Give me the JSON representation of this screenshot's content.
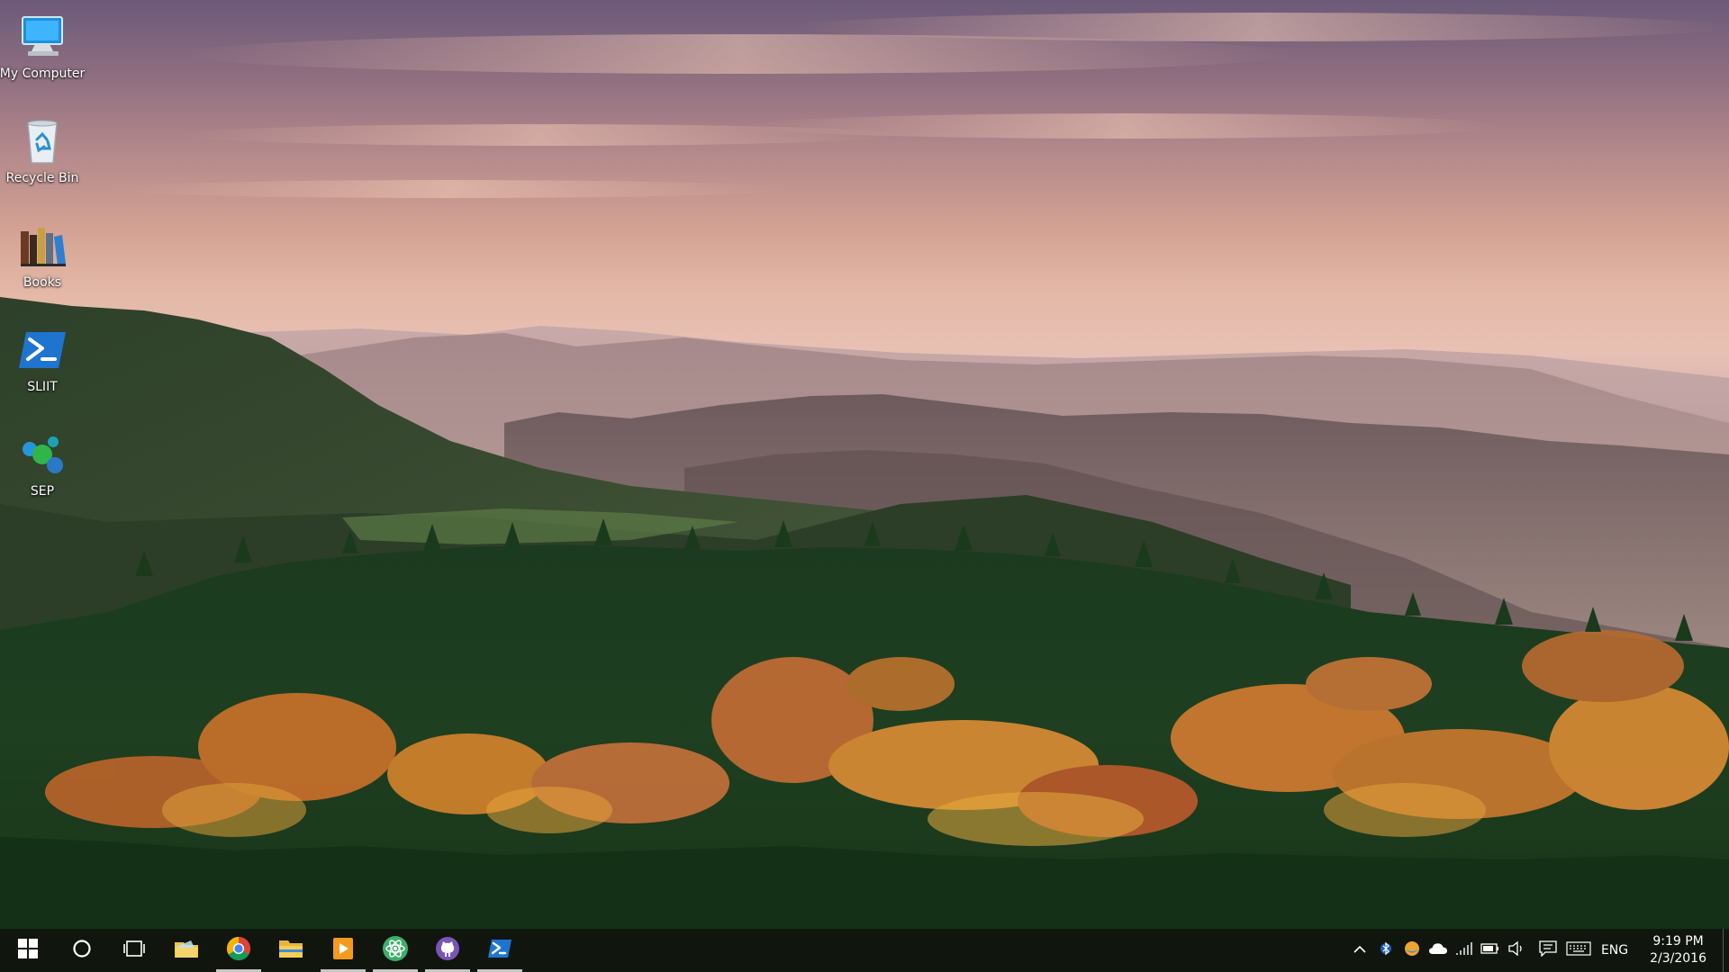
{
  "desktop": {
    "icons": [
      {
        "label": "My Computer",
        "icon": "computer-icon"
      },
      {
        "label": "Recycle Bin",
        "icon": "recycle-bin-icon"
      },
      {
        "label": "Books",
        "icon": "books-icon"
      },
      {
        "label": "SLIIT",
        "icon": "powershell-icon"
      },
      {
        "label": "SEP",
        "icon": "sep-icon"
      }
    ]
  },
  "taskbar": {
    "start": "windows-logo-icon",
    "search": "cortana-circle-icon",
    "task_view": "task-view-icon",
    "pinned": [
      {
        "name": "file-explorer-yellow-icon",
        "running": false
      },
      {
        "name": "chrome-icon",
        "running": true
      },
      {
        "name": "file-explorer-icon",
        "running": false
      },
      {
        "name": "media-player-icon",
        "running": true
      },
      {
        "name": "atom-icon",
        "running": true
      },
      {
        "name": "github-icon",
        "running": true
      },
      {
        "name": "powershell-icon",
        "running": true
      }
    ],
    "tray": {
      "icons": [
        "chevron-up-icon",
        "bluetooth-icon",
        "weather-icon",
        "onedrive-cloud-icon",
        "wifi-icon",
        "battery-icon",
        "volume-icon",
        "action-center-icon",
        "keyboard-icon"
      ],
      "language": "ENG",
      "time": "9:19 PM",
      "date": "2/3/2016"
    }
  },
  "colors": {
    "taskbar": "#10140e",
    "accent_running": "#c6c6c6",
    "label": "#ffffff"
  }
}
